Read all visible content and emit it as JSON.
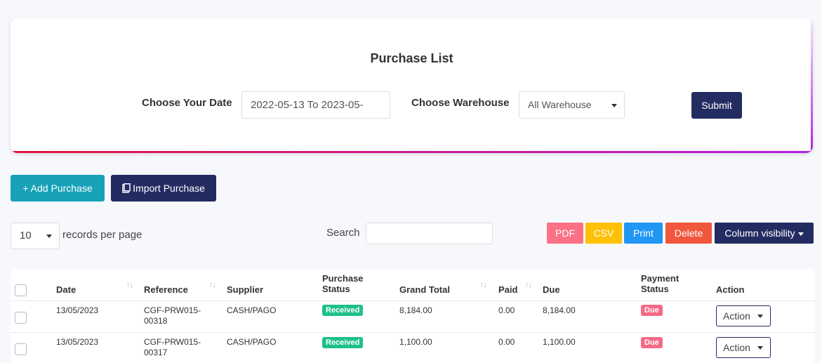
{
  "header": {
    "title": "Purchase List",
    "date_label": "Choose Your Date",
    "date_value": "2022-05-13 To 2023-05-",
    "warehouse_label": "Choose Warehouse",
    "warehouse_value": "All Warehouse",
    "submit_label": "Submit"
  },
  "actions": {
    "add_label": "+ Add Purchase",
    "import_label": "Import Purchase"
  },
  "table_controls": {
    "length_value": "10",
    "length_suffix": "records per page",
    "search_label": "Search",
    "export": {
      "pdf": "PDF",
      "csv": "CSV",
      "print": "Print",
      "delete": "Delete",
      "colvis": "Column visibility"
    }
  },
  "table": {
    "columns": {
      "date": "Date",
      "reference": "Reference",
      "supplier": "Supplier",
      "purchase_status_1": "Purchase",
      "purchase_status_2": "Status",
      "grand_total": "Grand Total",
      "paid": "Paid",
      "due": "Due",
      "payment_status_1": "Payment",
      "payment_status_2": "Status",
      "action": "Action"
    },
    "rows": [
      {
        "date": "13/05/2023",
        "ref_1": "CGF-PRW015-",
        "ref_2": "00318",
        "supplier": "CASH/PAGO",
        "status": "Received",
        "grand_total": "8,184.00",
        "paid": "0.00",
        "due": "8,184.00",
        "payment_status": "Due",
        "action": "Action"
      },
      {
        "date": "13/05/2023",
        "ref_1": "CGF-PRW015-",
        "ref_2": "00317",
        "supplier": "CASH/PAGO",
        "status": "Received",
        "grand_total": "1,100.00",
        "paid": "0.00",
        "due": "1,100.00",
        "payment_status": "Due",
        "action": "Action"
      }
    ]
  }
}
